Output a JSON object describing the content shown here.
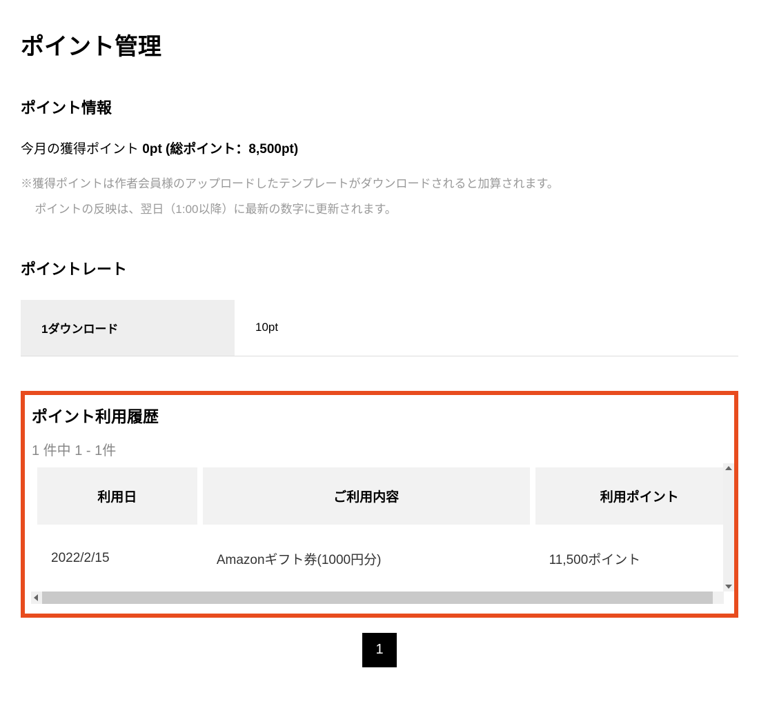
{
  "page_title": "ポイント管理",
  "info_section": {
    "title": "ポイント情報",
    "summary_label": "今月の獲得ポイント ",
    "summary_value": "0pt",
    "summary_paren_open": " (",
    "summary_total_label": "総ポイント：",
    "summary_total_value": "8,500pt",
    "summary_paren_close": ")",
    "note_line1": "※獲得ポイントは作者会員様のアップロードしたテンプレートがダウンロードされると加算されます。",
    "note_line2": "ポイントの反映は、翌日（1:00以降）に最新の数字に更新されます。"
  },
  "rate_section": {
    "title": "ポイントレート",
    "label": "1ダウンロード",
    "value": "10pt"
  },
  "history_section": {
    "title": "ポイント利用履歴",
    "count_text": "1 件中 1 - 1件",
    "columns": {
      "date": "利用日",
      "desc": "ご利用内容",
      "points": "利用ポイント"
    },
    "rows": [
      {
        "date": "2022/2/15",
        "desc": "Amazonギフト券(1000円分)",
        "points": "11,500ポイント"
      }
    ]
  },
  "pagination": {
    "current": "1"
  }
}
